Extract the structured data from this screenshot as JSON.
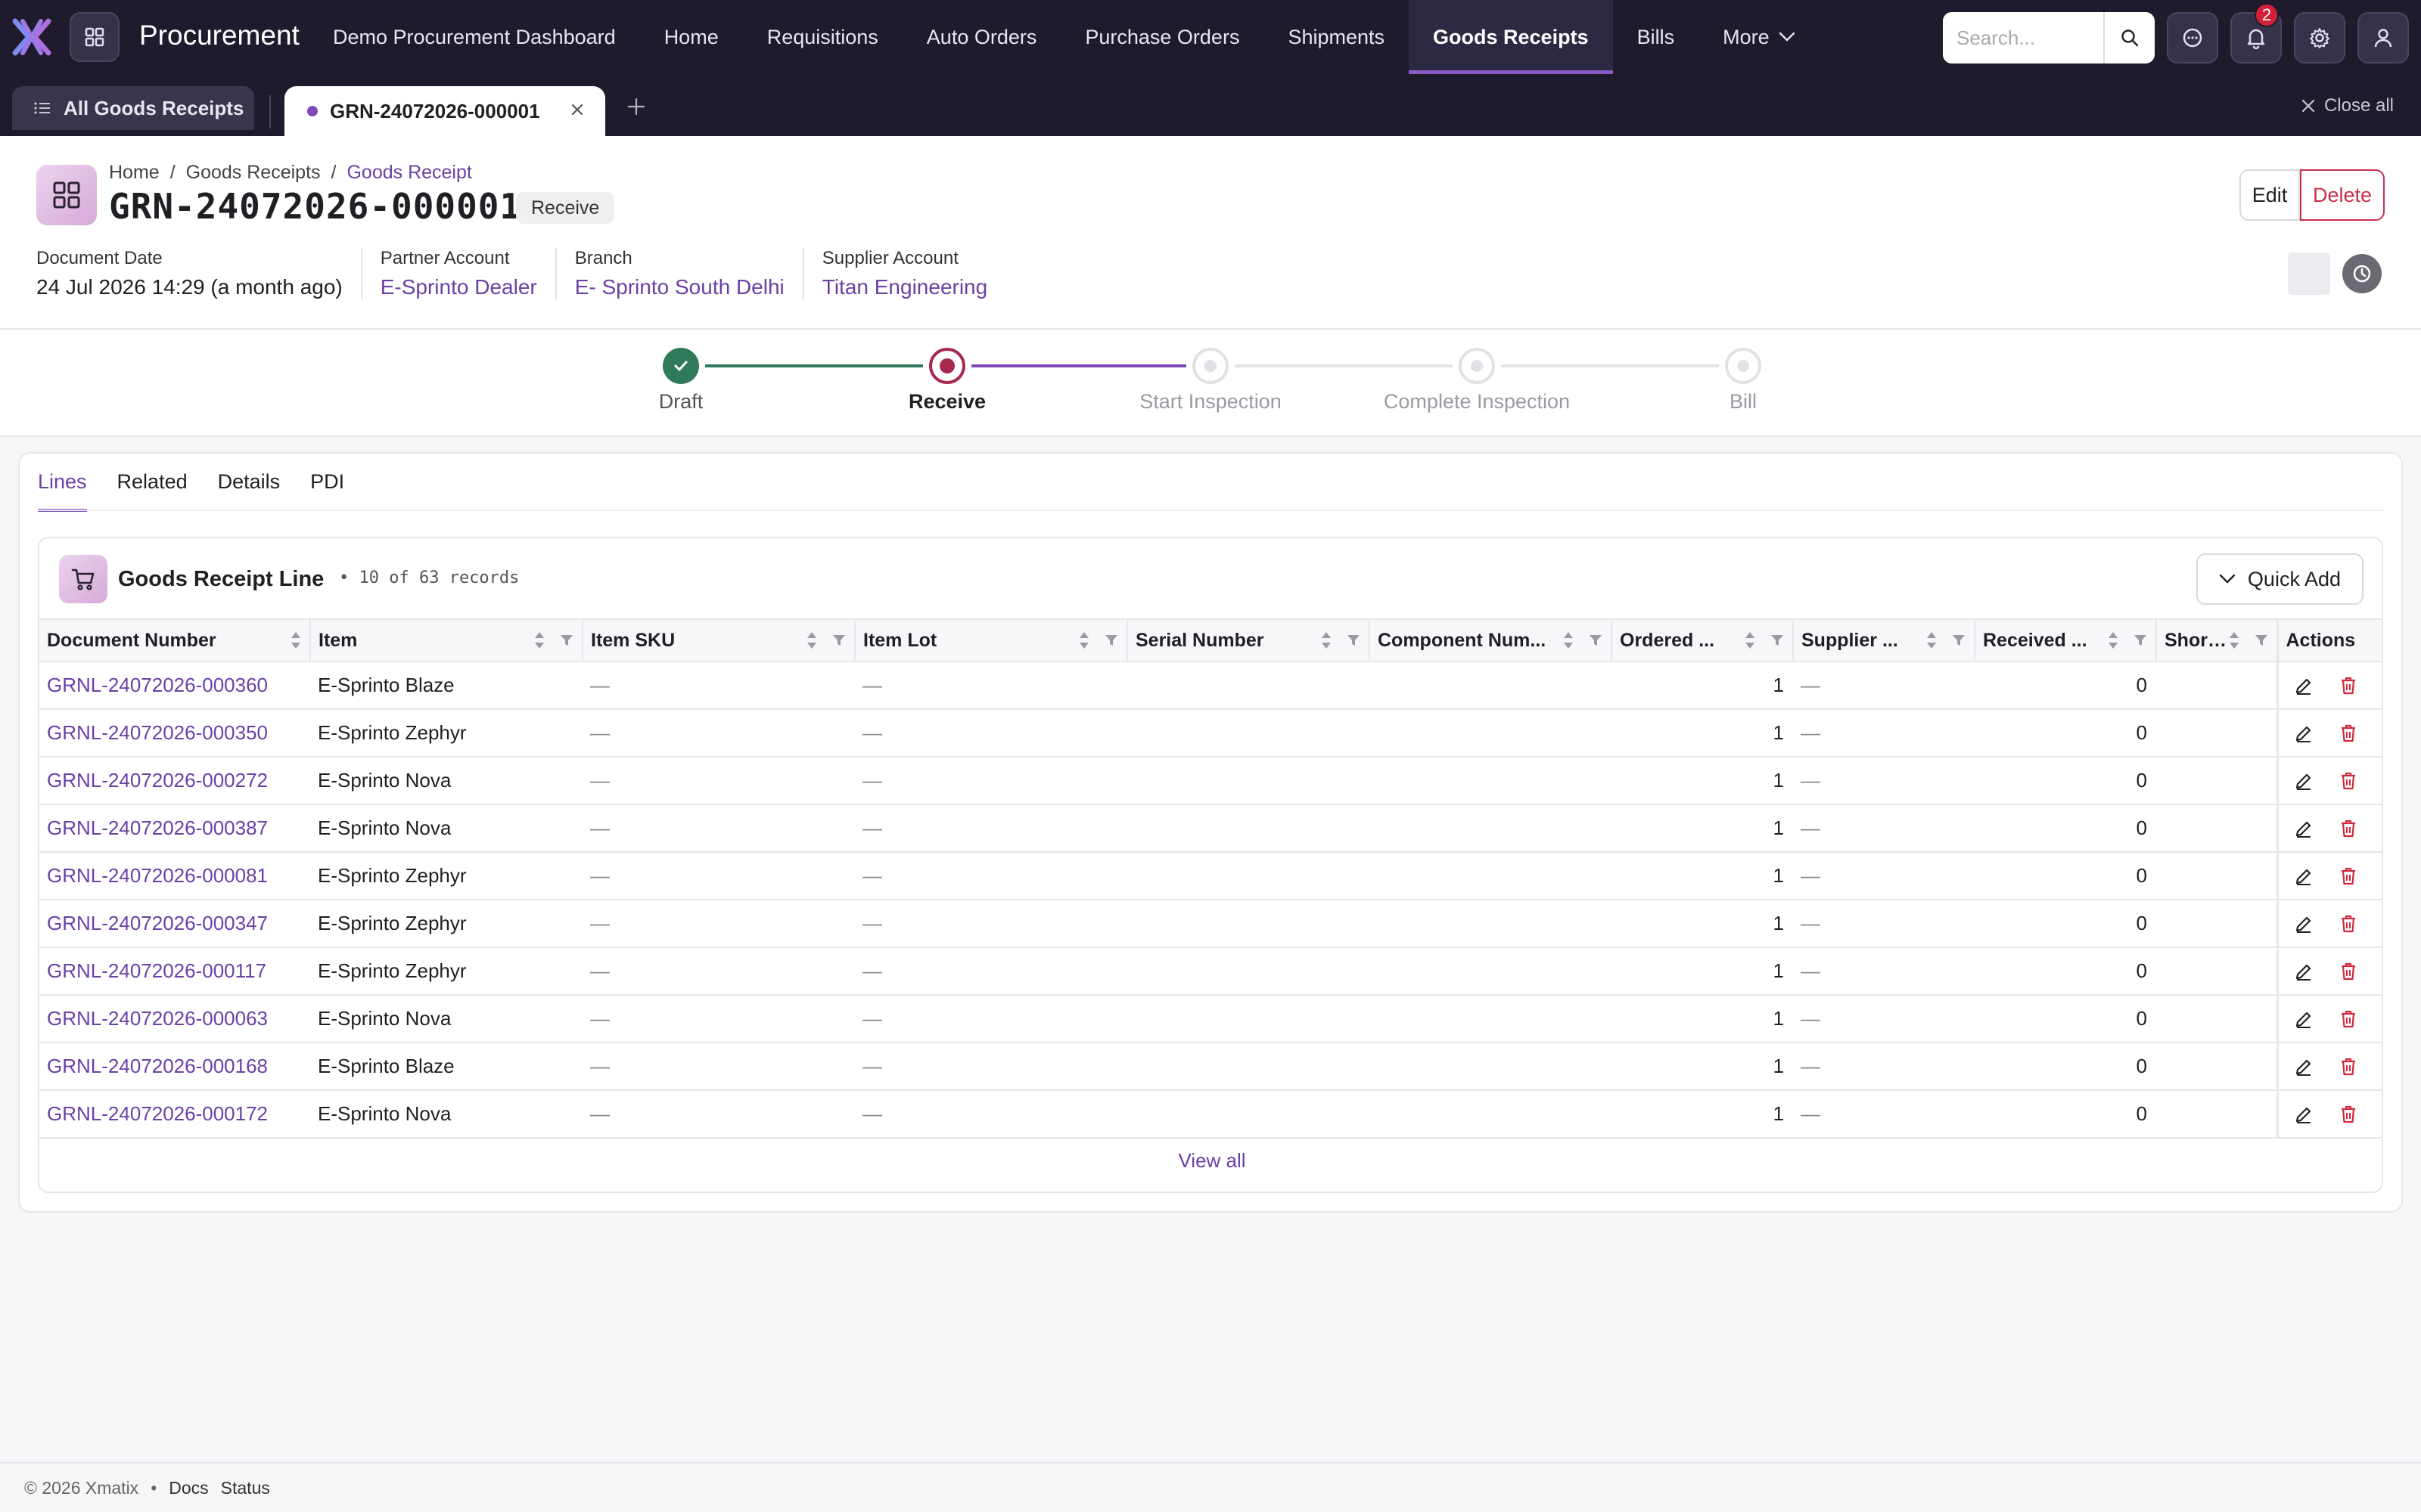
{
  "app": {
    "name": "Procurement",
    "nav": [
      "Demo Procurement Dashboard",
      "Home",
      "Requisitions",
      "Auto Orders",
      "Purchase Orders",
      "Shipments",
      "Goods Receipts",
      "Bills",
      "More"
    ],
    "active_nav": "Goods Receipts",
    "search_placeholder": "Search...",
    "notification_count": "2",
    "accent": "#6b3fa6"
  },
  "tabs": {
    "all": "All Goods Receipts",
    "current": "GRN-24072026-000001",
    "close_all": "Close all"
  },
  "header": {
    "breadcrumb": [
      "Home",
      "Goods Receipts",
      "Goods Receipt"
    ],
    "title": "GRN-24072026-000001",
    "status": "Receive",
    "edit_label": "Edit",
    "delete_label": "Delete",
    "fields": [
      {
        "label": "Document Date",
        "value": "24 Jul 2026 14:29 (a month ago)",
        "link": false
      },
      {
        "label": "Partner Account",
        "value": "E-Sprinto Dealer",
        "link": true
      },
      {
        "label": "Branch",
        "value": "E- Sprinto South Delhi",
        "link": true
      },
      {
        "label": "Supplier Account",
        "value": "Titan Engineering",
        "link": true
      }
    ]
  },
  "stepper": [
    {
      "label": "Draft",
      "state": "done"
    },
    {
      "label": "Receive",
      "state": "current"
    },
    {
      "label": "Start Inspection",
      "state": "pending"
    },
    {
      "label": "Complete Inspection",
      "state": "pending"
    },
    {
      "label": "Bill",
      "state": "pending"
    }
  ],
  "panel": {
    "tabs": [
      "Lines",
      "Related",
      "Details",
      "PDI"
    ],
    "active_tab": "Lines",
    "card_title": "Goods Receipt Line",
    "count": "• 10 of 63 records",
    "quick_add": "Quick Add",
    "view_all": "View all"
  },
  "table": {
    "columns": [
      "Document Number",
      "Item",
      "Item SKU",
      "Item Lot",
      "Serial Number",
      "Component Num...",
      "Ordered ...",
      "Supplier ...",
      "Received ...",
      "Shortage ...",
      "Actions"
    ],
    "rows": [
      [
        "GRNL-24072026-000360",
        "E-Sprinto Blaze",
        "—",
        "—",
        "",
        "",
        "1",
        "—",
        "0",
        ""
      ],
      [
        "GRNL-24072026-000350",
        "E-Sprinto Zephyr",
        "—",
        "—",
        "",
        "",
        "1",
        "—",
        "0",
        ""
      ],
      [
        "GRNL-24072026-000272",
        "E-Sprinto Nova",
        "—",
        "—",
        "",
        "",
        "1",
        "—",
        "0",
        ""
      ],
      [
        "GRNL-24072026-000387",
        "E-Sprinto Nova",
        "—",
        "—",
        "",
        "",
        "1",
        "—",
        "0",
        ""
      ],
      [
        "GRNL-24072026-000081",
        "E-Sprinto Zephyr",
        "—",
        "—",
        "",
        "",
        "1",
        "—",
        "0",
        ""
      ],
      [
        "GRNL-24072026-000347",
        "E-Sprinto Zephyr",
        "—",
        "—",
        "",
        "",
        "1",
        "—",
        "0",
        ""
      ],
      [
        "GRNL-24072026-000117",
        "E-Sprinto Zephyr",
        "—",
        "—",
        "",
        "",
        "1",
        "—",
        "0",
        ""
      ],
      [
        "GRNL-24072026-000063",
        "E-Sprinto Nova",
        "—",
        "—",
        "",
        "",
        "1",
        "—",
        "0",
        ""
      ],
      [
        "GRNL-24072026-000168",
        "E-Sprinto Blaze",
        "—",
        "—",
        "",
        "",
        "1",
        "—",
        "0",
        ""
      ],
      [
        "GRNL-24072026-000172",
        "E-Sprinto Nova",
        "—",
        "—",
        "",
        "",
        "1",
        "—",
        "0",
        ""
      ]
    ]
  },
  "footer": {
    "copyright": "© 2026 Xmatix",
    "sep": "•",
    "links": [
      "Docs",
      "Status"
    ]
  }
}
